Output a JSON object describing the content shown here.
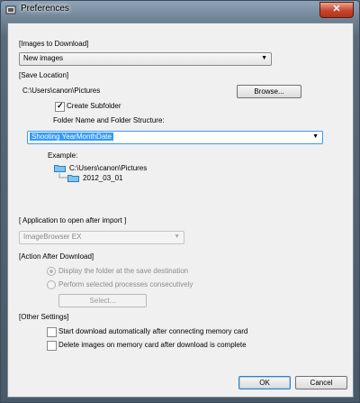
{
  "window": {
    "title": "Preferences",
    "close_glyph": "✕"
  },
  "images_to_download": {
    "heading": "[Images to Download]",
    "selected": "New images"
  },
  "save_location": {
    "heading": "[Save Location]",
    "path": "C:\\Users\\canon\\Pictures",
    "browse_label": "Browse...",
    "create_subfolder_label": "Create Subfolder",
    "create_subfolder_checked": true,
    "structure_label": "Folder Name and Folder Structure:",
    "structure_selected": "Shooting YearMonthDate",
    "example_label": "Example:",
    "example_root": "C:\\Users\\canon\\Pictures",
    "example_child": "2012_03_01"
  },
  "application": {
    "heading": "[ Application to open after import ]",
    "selected": "ImageBrowser EX"
  },
  "action": {
    "heading": "[Action After Download]",
    "option1": "Display the folder at the save destination",
    "option2": "Perform selected processes consecutively",
    "select_label": "Select..."
  },
  "other": {
    "heading": "[Other Settings]",
    "auto_download_label": "Start download automatically after connecting memory card",
    "delete_label": "Delete images on memory card after download is complete"
  },
  "footer": {
    "ok_label": "OK",
    "cancel_label": "Cancel"
  }
}
